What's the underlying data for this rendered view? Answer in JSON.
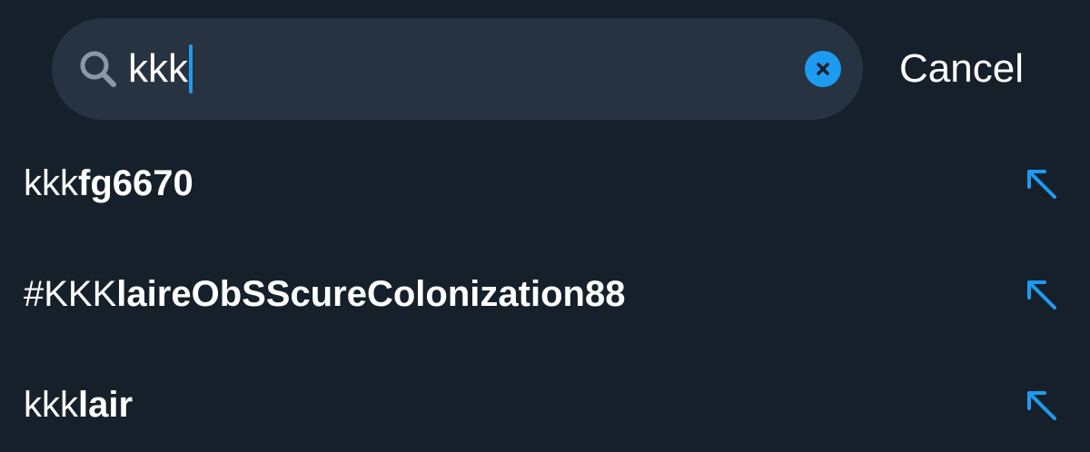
{
  "search": {
    "query": "kkk",
    "cancel_label": "Cancel"
  },
  "suggestions": [
    {
      "typed": "kkk",
      "rest": "fg6670"
    },
    {
      "typed": "#KKK",
      "rest": "laireObSScureColonization88"
    },
    {
      "typed": "kkk",
      "rest": "lair"
    }
  ],
  "colors": {
    "background": "#15202b",
    "search_field": "#273340",
    "accent": "#1d9bf0",
    "text": "#ffffff",
    "icon_muted": "#8b98a5"
  },
  "icons": {
    "search": "search-icon",
    "clear": "clear-icon",
    "fill_arrow": "arrow-up-left-icon"
  }
}
